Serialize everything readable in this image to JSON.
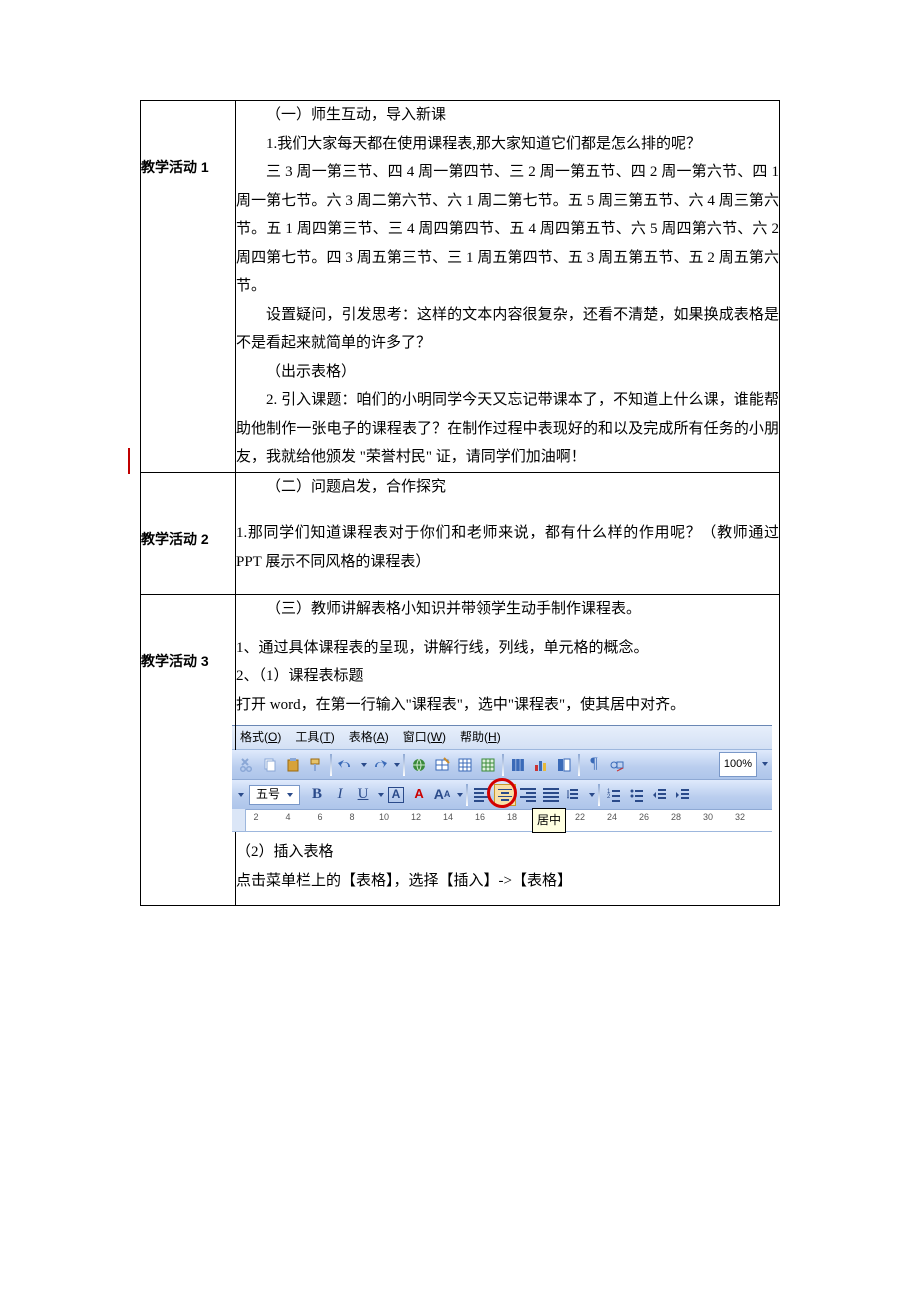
{
  "activity1": {
    "label": "教学活动 1",
    "title": "（一）师生互动，导入新课",
    "p1": "1.我们大家每天都在使用课程表,那大家知道它们都是怎么排的呢？",
    "p2": "三 3 周一第三节、四 4 周一第四节、三 2 周一第五节、四 2 周一第六节、四 1 周一第七节。六 3 周二第六节、六 1 周二第七节。五 5 周三第五节、六 4 周三第六节。五 1 周四第三节、三 4 周四第四节、五 4 周四第五节、六 5 周四第六节、六 2 周四第七节。四 3 周五第三节、三 1 周五第四节、五 3 周五第五节、五 2 周五第六节。",
    "p3": "设置疑问，引发思考：这样的文本内容很复杂，还看不清楚，如果换成表格是不是看起来就简单的许多了？",
    "p4": "（出示表格）",
    "p5": "2. 引入课题：咱们的小明同学今天又忘记带课本了，不知道上什么课，谁能帮助他制作一张电子的课程表了？在制作过程中表现好的和以及完成所有任务的小朋友，我就给他颁发 \"荣誉村民\" 证，请同学们加油啊！"
  },
  "activity2": {
    "label": "教学活动 2",
    "title": "（二）问题启发，合作探究",
    "p1": "1.那同学们知道课程表对于你们和老师来说，都有什么样的作用呢？（教师通过 PPT 展示不同风格的课程表）"
  },
  "activity3": {
    "label": "教学活动 3",
    "title": "（三）教师讲解表格小知识并带领学生动手制作课程表。",
    "p1": "1、通过具体课程表的呈现，讲解行线，列线，单元格的概念。",
    "p2": "2、（1）课程表标题",
    "p3": "打开 word，在第一行输入\"课程表\"，选中\"课程表\"，使其居中对齐。",
    "p4": "（2）插入表格",
    "p5": "点击菜单栏上的【表格】，选择【插入】->【表格】"
  },
  "toolbar": {
    "menus": {
      "format": "格式(O)",
      "tools": "工具(T)",
      "table": "表格(A)",
      "window": "窗口(W)",
      "help": "帮助(H)"
    },
    "zoom_value": "100%",
    "font_size_label": "五号",
    "ruler_numbers": [
      "2",
      "4",
      "6",
      "8",
      "10",
      "12",
      "14",
      "16",
      "18",
      "22",
      "24",
      "26",
      "28",
      "30",
      "32"
    ],
    "tooltip_center": "居中"
  }
}
